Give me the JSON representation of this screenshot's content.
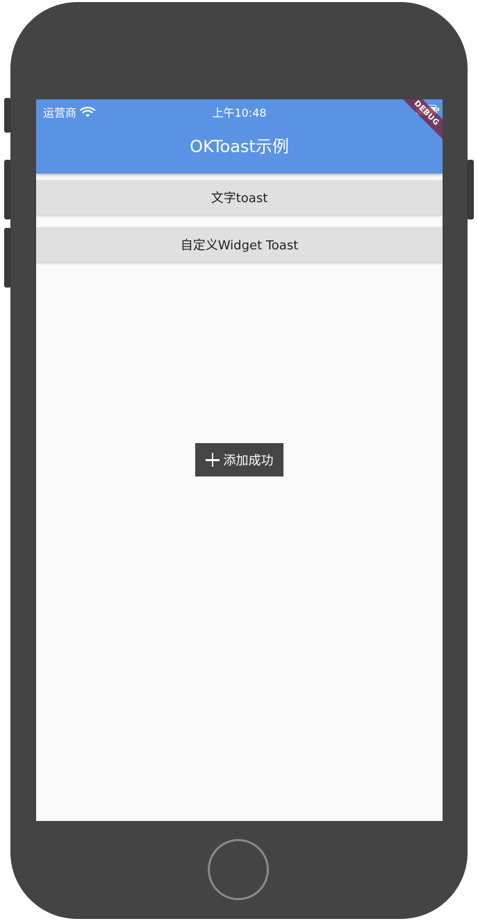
{
  "status_bar": {
    "carrier": "运营商",
    "time": "上午10:48"
  },
  "app_bar": {
    "title": "OKToast示例",
    "debug_banner": "DEBUG"
  },
  "buttons": [
    {
      "label": "文字toast"
    },
    {
      "label": "自定义Widget Toast"
    }
  ],
  "toast": {
    "icon": "plus-icon",
    "text": "添加成功"
  },
  "colors": {
    "app_bar": "#5a93e4",
    "button": "#e0e0e0",
    "toast": "#454545",
    "background": "#fafafa",
    "phone_frame": "#444444"
  }
}
